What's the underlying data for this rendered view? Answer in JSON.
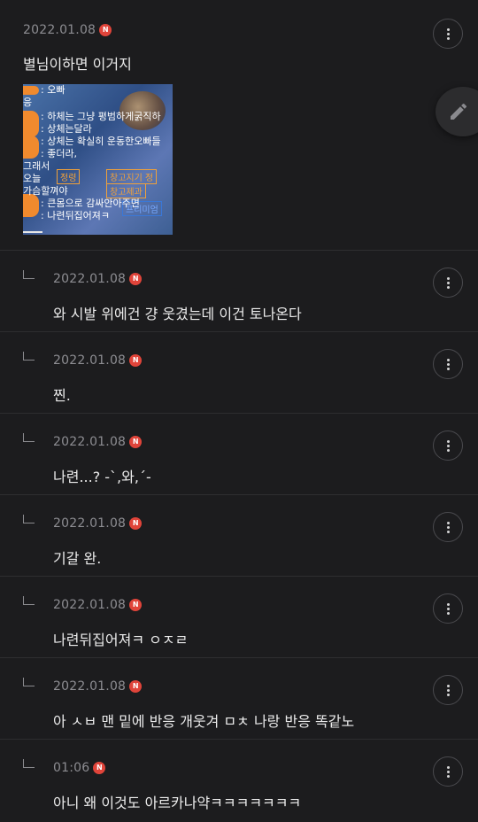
{
  "badge": "N",
  "comments": [
    {
      "date": "2022.01.08",
      "text": "별님이하면 이거지"
    },
    {
      "date": "2022.01.08",
      "text": "와 시발 위에건 걍 웃겼는데 이건 토나온다"
    },
    {
      "date": "2022.01.08",
      "text": "찐."
    },
    {
      "date": "2022.01.08",
      "text": "나련...? -`,와,´-"
    },
    {
      "date": "2022.01.08",
      "text": "기갈 완."
    },
    {
      "date": "2022.01.08",
      "text": "나련뒤집어져ㅋ ㅇㅈㄹ"
    },
    {
      "date": "2022.01.08",
      "text": "아 ㅅㅂ 맨 밑에 반응 개웃겨 ㅁㅊ 나랑 반응 똑같노"
    },
    {
      "date": "01:06",
      "text": "아니 왜 이것도 아르카나약ㅋㅋㅋㅋㅋㅋㅋ"
    }
  ],
  "attachment": {
    "lines": [
      ": 오빠",
      "응",
      ": 하체는 그냥 평범하게굵직하",
      ": 상체는달라",
      ": 상체는 확실히 운동한오빠들",
      ": 좋더라,",
      "그래서",
      "오늘",
      "가슴할껴야",
      ": 큰몸으로 감싸안아주면",
      ": 나련뒤집어져ㅋ"
    ],
    "tags": [
      "정령",
      "창고지기 정",
      "창고제과",
      "프리미엄"
    ]
  },
  "icons": {
    "more": "more-vertical-icon",
    "reply": "reply-arrow-icon",
    "edit": "pencil-icon"
  },
  "colors": {
    "background": "#1c1c1e",
    "badge": "#e0443a",
    "date": "#8d8d92"
  }
}
